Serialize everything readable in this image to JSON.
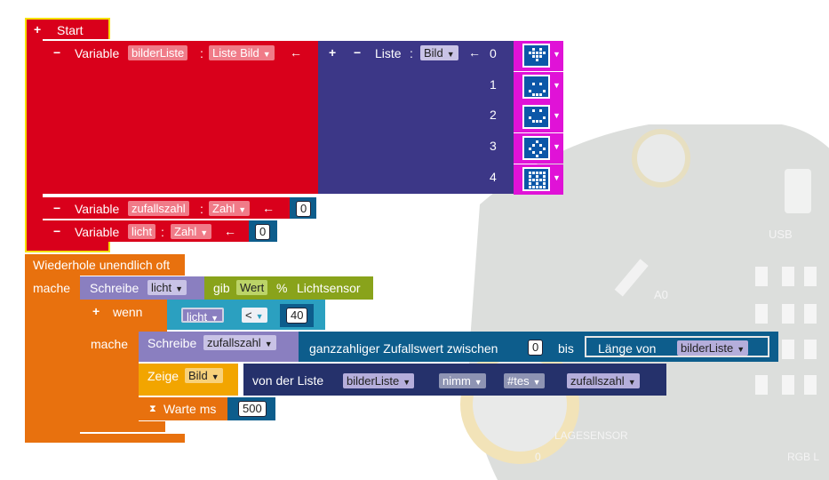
{
  "blocks": {
    "start": {
      "plus": "+",
      "label": "Start"
    },
    "var1": {
      "minus": "−",
      "label": "Variable",
      "name": "bilderListe",
      "colon": ":",
      "type": "Liste Bild",
      "arrow": "←"
    },
    "list": {
      "plus": "+",
      "minus": "−",
      "label": "Liste",
      "colon": ":",
      "type": "Bild",
      "arrow": "←",
      "indices": [
        "0",
        "1",
        "2",
        "3",
        "4"
      ]
    },
    "var2": {
      "minus": "−",
      "label": "Variable",
      "name": "zufallszahl",
      "colon": ":",
      "type": "Zahl",
      "arrow": "←",
      "value": "0"
    },
    "var3": {
      "minus": "−",
      "label": "Variable",
      "name": "licht",
      "colon": ":",
      "type": "Zahl",
      "arrow": "←",
      "value": "0"
    },
    "loop": {
      "label": "Wiederhole unendlich oft",
      "do": "mache"
    },
    "write1": {
      "label": "Schreibe",
      "var": "licht",
      "get": "gib",
      "value": "Wert",
      "percent": "%",
      "sensor": "Lichtsensor"
    },
    "if": {
      "plus": "+",
      "label": "wenn",
      "var": "licht",
      "op": "<",
      "value": "40",
      "do": "mache"
    },
    "write2": {
      "label": "Schreibe",
      "var": "zufallszahl",
      "random": "ganzzahliger Zufallswert zwischen",
      "from": "0",
      "to": "bis",
      "length": "Länge von",
      "list": "bilderListe"
    },
    "show": {
      "label": "Zeige",
      "type": "Bild",
      "from": "von der Liste",
      "list": "bilderListe",
      "take": "nimm",
      "index": "#tes",
      "var": "zufallszahl"
    },
    "wait": {
      "label": "Warte ms",
      "value": "500"
    }
  },
  "board": {
    "usb": "USB",
    "a0": "A0",
    "lagesensor": "LAGESENSOR",
    "rgb": "RGB L",
    "zero": "0"
  },
  "colors": {
    "start": "#d9001b",
    "list": "#3c3787",
    "loop": "#e8710e",
    "write": "#8a7fc0",
    "olive": "#89a31b",
    "teal": "#2ba0c0",
    "navy": "#25316b",
    "image": "#e012d7",
    "show": "#f2a500"
  }
}
